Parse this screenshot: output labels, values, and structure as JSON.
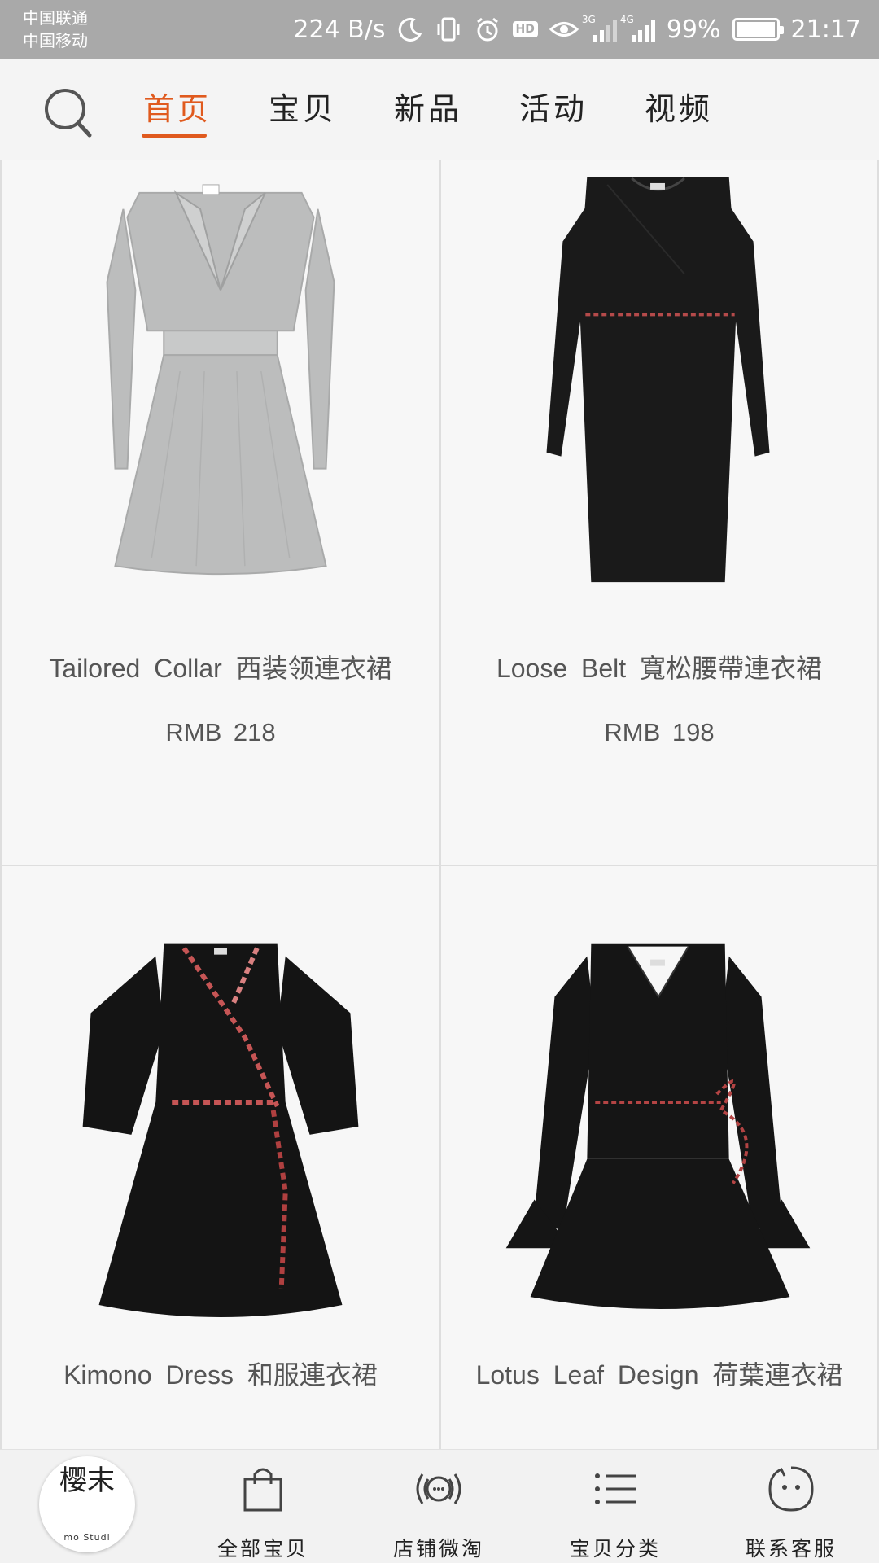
{
  "status_bar": {
    "carrier1": "中国联通",
    "carrier2": "中国移动",
    "speed": "224 B/s",
    "net1": "3G",
    "net2": "4G",
    "battery": "99%",
    "battery_level": 0.99,
    "time": "21:17",
    "hd": "HD"
  },
  "nav": {
    "tabs": [
      {
        "label": "首页",
        "active": true
      },
      {
        "label": "宝贝"
      },
      {
        "label": "新品"
      },
      {
        "label": "活动"
      },
      {
        "label": "视频"
      }
    ]
  },
  "products": [
    {
      "name": "Tailored Collar 西装领連衣裙",
      "price": "RMB 218",
      "color": "#bfc0c0"
    },
    {
      "name": "Loose Belt 寬松腰帶連衣裙",
      "price": "RMB 198",
      "color": "#1a1a1a"
    },
    {
      "name": "Kimono Dress 和服連衣裙",
      "price": "",
      "color": "#141414"
    },
    {
      "name": "Lotus Leaf Design 荷葉連衣裙",
      "price": "",
      "color": "#151515"
    }
  ],
  "bottom_bar": {
    "logo_chinese": "樱末",
    "logo_english": "mo Studi",
    "tabs": [
      {
        "label": "全部宝贝",
        "icon": "bag-icon"
      },
      {
        "label": "店铺微淘",
        "icon": "broadcast-icon"
      },
      {
        "label": "宝贝分类",
        "icon": "list-icon"
      },
      {
        "label": "联系客服",
        "icon": "chat-face-icon"
      }
    ]
  },
  "colors": {
    "accent": "#e05a1e",
    "status_bar_bg": "#a9a9a9"
  }
}
